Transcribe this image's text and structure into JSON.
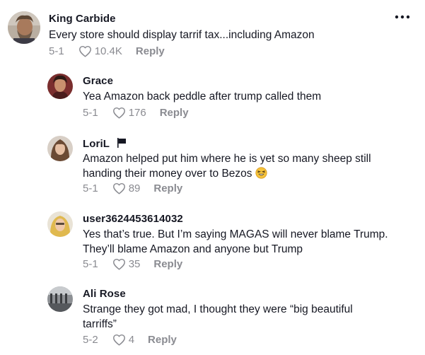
{
  "comments": [
    {
      "author": "King Carbide",
      "text": "Every store should display tarrif tax...including Amazon",
      "date": "5-1",
      "likes": "10.4K",
      "reply": "Reply"
    },
    {
      "author": "Grace",
      "text": "Yea Amazon back peddle after trump called them",
      "date": "5-1",
      "likes": "176",
      "reply": "Reply"
    },
    {
      "author": "LoriL",
      "text_line1": "Amazon helped put him where he is yet so many sheep still",
      "text_line2": "handing their money over to Bezos",
      "date": "5-1",
      "likes": "89",
      "reply": "Reply"
    },
    {
      "author": "user3624453614032",
      "text_line1": "Yes that’s true. But I’m saying MAGAS will never blame Trump.",
      "text_line2": "They’ll blame Amazon and anyone but Trump",
      "date": "5-1",
      "likes": "35",
      "reply": "Reply"
    },
    {
      "author": "Ali Rose",
      "text_line1": "Strange they got mad, I thought they were “big beautiful",
      "text_line2": "tarriffs”",
      "date": "5-2",
      "likes": "4",
      "reply": "Reply"
    }
  ],
  "icons": {
    "more": "more-options-icon",
    "like": "heart-outline-icon",
    "flag": "flag-icon",
    "emoji": "laughing-face-emoji-icon"
  },
  "colors": {
    "text": "#161823",
    "meta": "#8a8b91",
    "background": "#ffffff"
  }
}
